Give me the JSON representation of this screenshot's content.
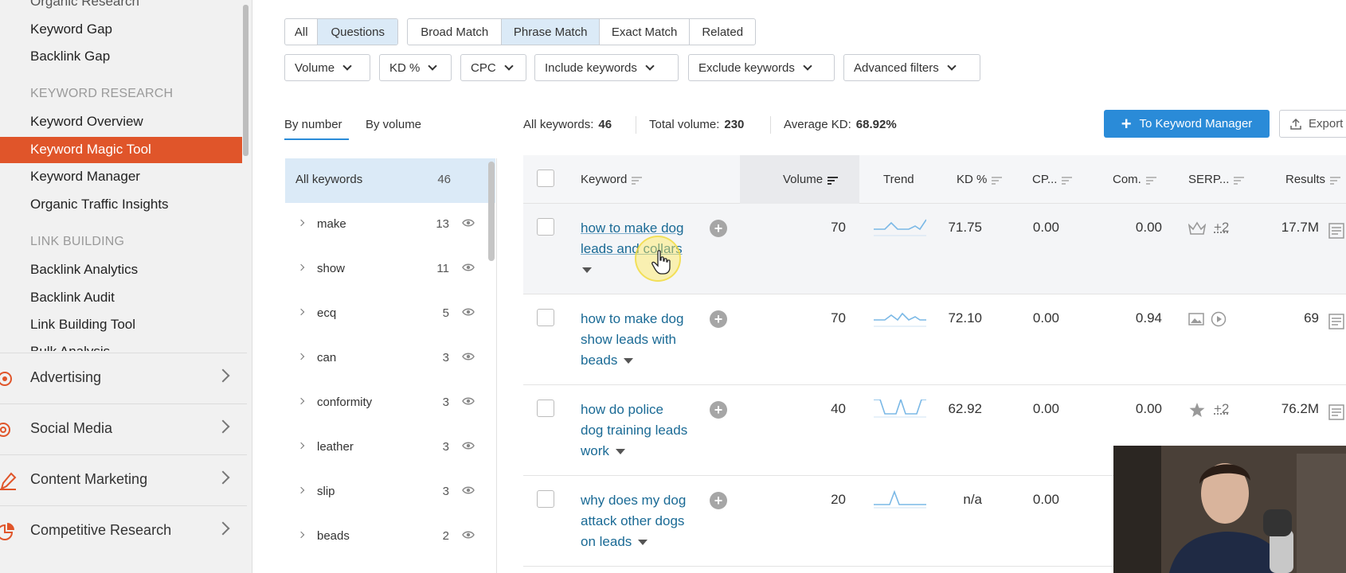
{
  "sidebar": {
    "top_cut": "Organic Research",
    "items_a": [
      "Keyword Gap",
      "Backlink Gap"
    ],
    "heading_kr": "KEYWORD RESEARCH",
    "items_kr": [
      "Keyword Overview",
      "Keyword Magic Tool",
      "Keyword Manager",
      "Organic Traffic Insights"
    ],
    "heading_lb": "LINK BUILDING",
    "items_lb": [
      "Backlink Analytics",
      "Backlink Audit",
      "Link Building Tool",
      "Bulk Analysis"
    ],
    "categories": [
      "Advertising",
      "Social Media",
      "Content Marketing",
      "Competitive Research"
    ]
  },
  "filters": {
    "type_tabs": [
      "All",
      "Questions"
    ],
    "match_tabs": [
      "Broad Match",
      "Phrase Match",
      "Exact Match",
      "Related"
    ],
    "dropdowns": [
      "Volume",
      "KD %",
      "CPC",
      "Include keywords",
      "Exclude keywords",
      "Advanced filters"
    ]
  },
  "groups": {
    "tabs": [
      "By number",
      "By volume"
    ],
    "all_label": "All keywords",
    "all_count": "46",
    "items": [
      {
        "name": "make",
        "count": "13"
      },
      {
        "name": "show",
        "count": "11"
      },
      {
        "name": "ecq",
        "count": "5"
      },
      {
        "name": "can",
        "count": "3"
      },
      {
        "name": "conformity",
        "count": "3"
      },
      {
        "name": "leather",
        "count": "3"
      },
      {
        "name": "slip",
        "count": "3"
      },
      {
        "name": "beads",
        "count": "2"
      }
    ]
  },
  "summary": {
    "all_label": "All keywords:",
    "all_value": "46",
    "vol_label": "Total volume:",
    "vol_value": "230",
    "kd_label": "Average KD:",
    "kd_value": "68.92%"
  },
  "actions": {
    "keyword_manager": "To Keyword Manager",
    "export": "Export"
  },
  "table": {
    "headers": [
      "Keyword",
      "Volume",
      "Trend",
      "KD %",
      "CP...",
      "Com.",
      "SERP...",
      "Results"
    ],
    "rows": [
      {
        "kw1": "how to make dog",
        "kw2": "leads and collars",
        "kw3": "",
        "volume": "70",
        "kd": "71.75",
        "cpc": "0.00",
        "com": "0.00",
        "serp_extra": "+2",
        "results": "17.7M"
      },
      {
        "kw1": "how to make dog",
        "kw2": "show leads with",
        "kw3": "beads",
        "volume": "70",
        "kd": "72.10",
        "cpc": "0.00",
        "com": "0.94",
        "serp_extra": "",
        "results": "69"
      },
      {
        "kw1": "how do police",
        "kw2": "dog training leads",
        "kw3": "work",
        "volume": "40",
        "kd": "62.92",
        "cpc": "0.00",
        "com": "0.00",
        "serp_extra": "+2",
        "results": "76.2M"
      },
      {
        "kw1": "why does my dog",
        "kw2": "attack other dogs",
        "kw3": "on leads",
        "volume": "20",
        "kd": "n/a",
        "cpc": "0.00",
        "com": "",
        "serp_extra": "",
        "results": ""
      }
    ]
  },
  "colors": {
    "accent_orange": "#e0552a",
    "primary_blue": "#2a8bd8",
    "link_blue": "#1a6a95",
    "selected_bg": "#dbeaf7"
  }
}
